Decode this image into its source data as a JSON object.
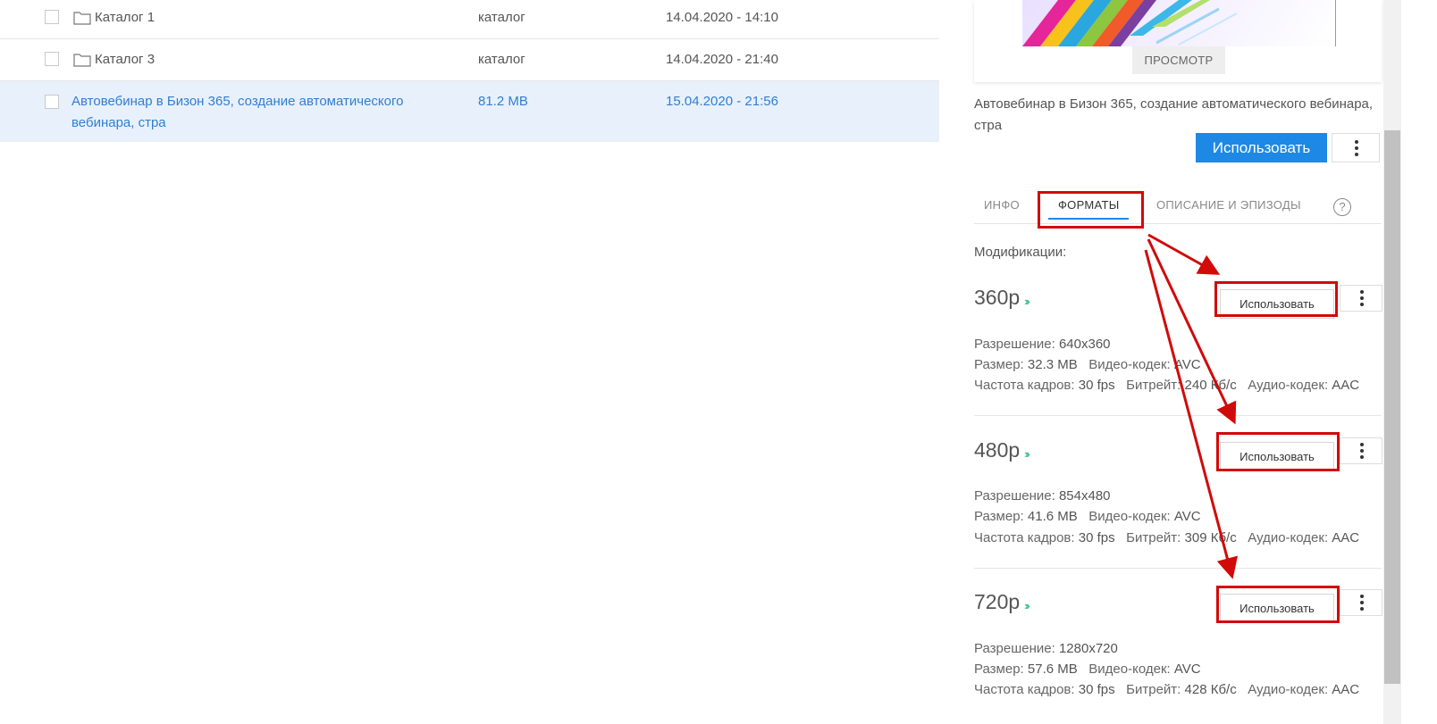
{
  "files": [
    {
      "name": "Каталог 1",
      "type": "каталог",
      "date": "14.04.2020 - 14:10",
      "is_folder": true
    },
    {
      "name": "Каталог 3",
      "type": "каталог",
      "date": "14.04.2020 - 21:40",
      "is_folder": true
    },
    {
      "name": "Автовебинар в Бизон 365, создание автоматического вебинара, стра",
      "type": "81.2 MB",
      "date": "15.04.2020 - 21:56",
      "is_folder": false,
      "selected": true
    }
  ],
  "panel": {
    "preview_label": "ПРОСМОТР",
    "title": "Автовебинар в Бизон 365, создание автоматического вебинара, стра",
    "use_label": "Использовать",
    "tabs": [
      "ИНФО",
      "ФОРМАТЫ",
      "ОПИСАНИЕ И ЭПИЗОДЫ"
    ],
    "active_tab": "ФОРМАТЫ",
    "help_glyph": "?",
    "mods_label": "Модификации:",
    "formats": [
      {
        "name": "360p",
        "resolution": "640x360",
        "size": "32.3 MB",
        "codec": "AVC",
        "fps": "30 fps",
        "bitrate": "240 Кб/с",
        "audio": "AAC",
        "use_label": "Использовать"
      },
      {
        "name": "480p",
        "resolution": "854x480",
        "size": "41.6 MB",
        "codec": "AVC",
        "fps": "30 fps",
        "bitrate": "309 Кб/с",
        "audio": "AAC",
        "use_label": "Использовать"
      },
      {
        "name": "720p",
        "resolution": "1280x720",
        "size": "57.6 MB",
        "codec": "AVC",
        "fps": "30 fps",
        "bitrate": "428 Кб/с",
        "audio": "AAC",
        "use_label": "Использовать"
      }
    ],
    "labels": {
      "resolution": "Разрешение:",
      "size": "Размер:",
      "codec": "Видео-кодек:",
      "fps": "Частота кадров:",
      "bitrate": "Битрейт:",
      "audio": "Аудио-кодек:"
    },
    "arrows_glyph": "›››"
  },
  "colors": {
    "accent": "#1e88e5",
    "selected_row": "#e8f0fb",
    "annotation": "#d10a0a",
    "quality_arrows": "#3dbf8a"
  }
}
